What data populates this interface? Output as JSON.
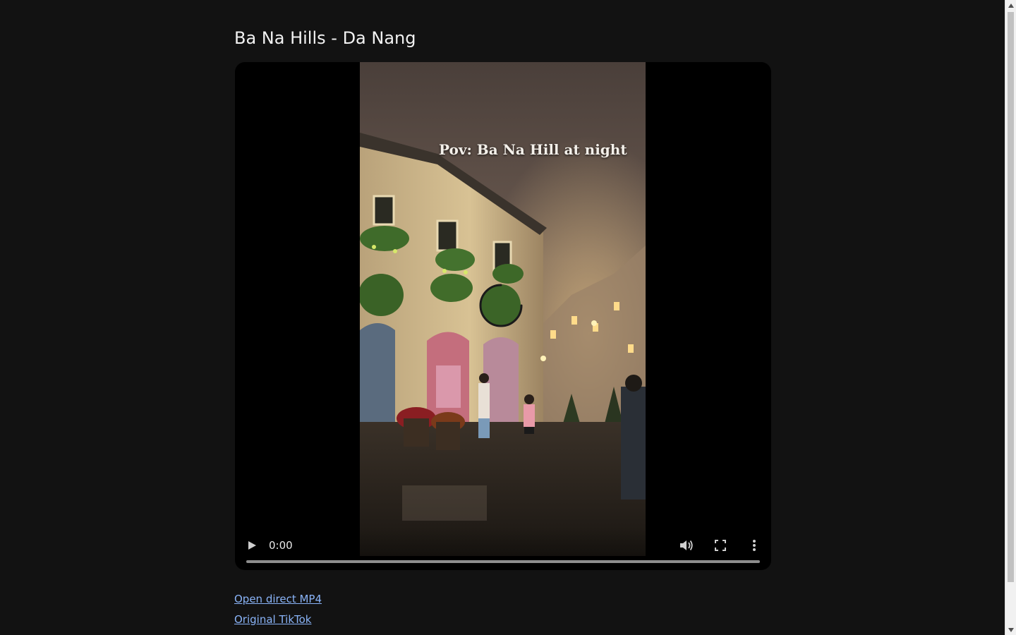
{
  "page": {
    "title": "Ba Na Hills - Da Nang"
  },
  "video": {
    "overlay_caption": "Pov: Ba Na Hill at night",
    "current_time": "0:00",
    "progress": 0,
    "state": "loading"
  },
  "controls": {
    "play_icon": "play-icon",
    "volume_icon": "volume-icon",
    "fullscreen_icon": "fullscreen-icon",
    "more_icon": "more-options-icon"
  },
  "links": {
    "direct_mp4": "Open direct MP4",
    "original_tiktok": "Original TikTok"
  },
  "colors": {
    "background": "#121212",
    "link": "#8ab4f8",
    "player": "#000000"
  }
}
